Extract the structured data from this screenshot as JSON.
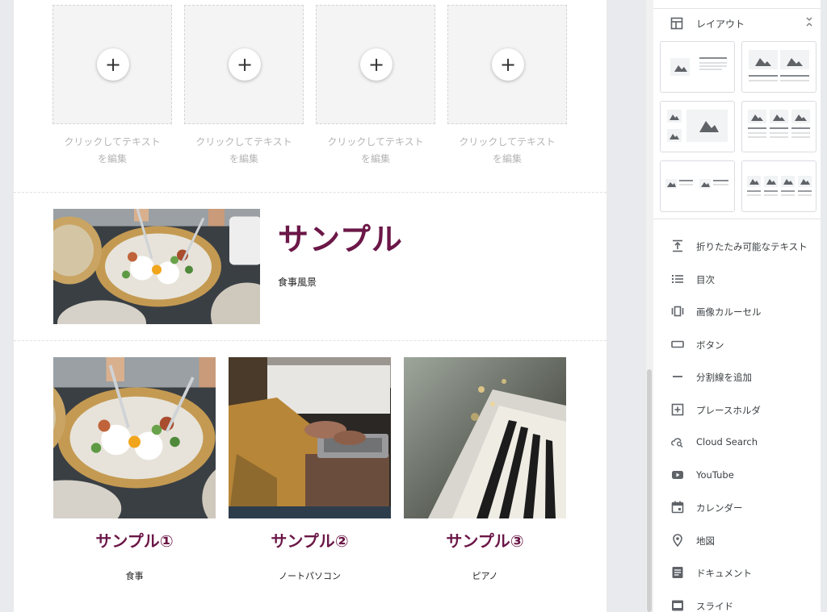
{
  "canvas": {
    "placeholders": [
      {
        "caption_line1": "クリックしてテキスト",
        "caption_line2": "を編集"
      },
      {
        "caption_line1": "クリックしてテキスト",
        "caption_line2": "を編集"
      },
      {
        "caption_line1": "クリックしてテキスト",
        "caption_line2": "を編集"
      },
      {
        "caption_line1": "クリックしてテキスト",
        "caption_line2": "を編集"
      }
    ],
    "add_symbol": "+",
    "feature": {
      "title": "サンプル",
      "subtitle": "食事風景",
      "image": "food-plates-photo"
    },
    "cards": [
      {
        "title": "サンプル①",
        "subtitle": "食事",
        "image": "food-plates-photo"
      },
      {
        "title": "サンプル②",
        "subtitle": "ノートパソコン",
        "image": "laptop-typing-photo"
      },
      {
        "title": "サンプル③",
        "subtitle": "ピアノ",
        "image": "piano-keys-photo"
      }
    ],
    "accent_color": "#6b1747"
  },
  "panel": {
    "layout_label": "レイアウト",
    "insert_items": [
      {
        "label": "折りたたみ可能なテキスト",
        "icon": "collapsible-text-icon"
      },
      {
        "label": "目次",
        "icon": "table-of-contents-icon"
      },
      {
        "label": "画像カルーセル",
        "icon": "image-carousel-icon"
      },
      {
        "label": "ボタン",
        "icon": "button-icon"
      },
      {
        "label": "分割線を追加",
        "icon": "divider-icon"
      },
      {
        "label": "プレースホルダ",
        "icon": "placeholder-icon"
      },
      {
        "label": "Cloud Search",
        "icon": "cloud-search-icon"
      },
      {
        "label": "YouTube",
        "icon": "youtube-icon"
      },
      {
        "label": "カレンダー",
        "icon": "calendar-icon"
      },
      {
        "label": "地図",
        "icon": "map-pin-icon"
      },
      {
        "label": "ドキュメント",
        "icon": "document-icon"
      },
      {
        "label": "スライド",
        "icon": "slides-icon"
      }
    ]
  }
}
